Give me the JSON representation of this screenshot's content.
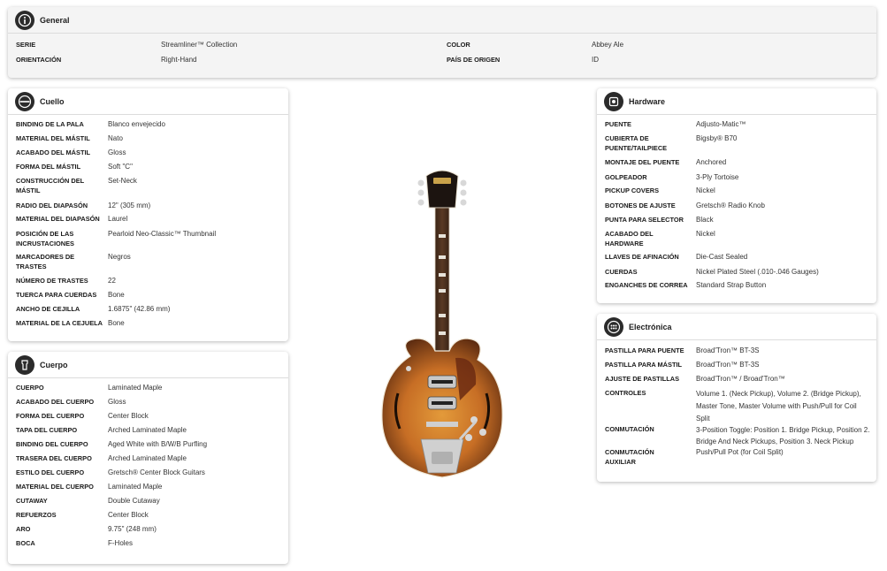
{
  "general": {
    "title": "General",
    "rows": [
      {
        "label": "SERIE",
        "value": "Streamliner™ Collection"
      },
      {
        "label": "ORIENTACIÓN",
        "value": "Right-Hand"
      },
      {
        "label": "COLOR",
        "value": "Abbey Ale"
      },
      {
        "label": "PAÍS DE ORIGEN",
        "value": "ID"
      }
    ]
  },
  "cuello": {
    "title": "Cuello",
    "rows": [
      {
        "label": "BINDING DE LA PALA",
        "value": "Blanco envejecido"
      },
      {
        "label": "MATERIAL DEL MÁSTIL",
        "value": "Nato"
      },
      {
        "label": "ACABADO DEL MÁSTIL",
        "value": "Gloss"
      },
      {
        "label": "FORMA DEL MÁSTIL",
        "value": "Soft \"C\""
      },
      {
        "label": "CONSTRUCCIÓN DEL MÁSTIL",
        "value": "Set-Neck"
      },
      {
        "label": "RADIO DEL DIAPASÓN",
        "value": "12\" (305 mm)"
      },
      {
        "label": "MATERIAL DEL DIAPASÓN",
        "value": "Laurel"
      },
      {
        "label": "POSICIÓN DE LAS INCRUSTACIONES",
        "value": "Pearloid Neo-Classic™ Thumbnail"
      },
      {
        "label": "MARCADORES DE TRASTES",
        "value": "Negros"
      },
      {
        "label": "NÚMERO DE TRASTES",
        "value": "22"
      },
      {
        "label": "TUERCA PARA CUERDAS",
        "value": "Bone"
      },
      {
        "label": "ANCHO DE CEJILLA",
        "value": "1.6875\" (42.86 mm)"
      },
      {
        "label": "MATERIAL DE LA CEJUELA",
        "value": "Bone"
      }
    ]
  },
  "cuerpo": {
    "title": "Cuerpo",
    "rows": [
      {
        "label": "CUERPO",
        "value": "Laminated Maple"
      },
      {
        "label": "ACABADO DEL CUERPO",
        "value": "Gloss"
      },
      {
        "label": "FORMA DEL CUERPO",
        "value": "Center Block"
      },
      {
        "label": "TAPA DEL CUERPO",
        "value": "Arched Laminated Maple"
      },
      {
        "label": "BINDING DEL CUERPO",
        "value": "Aged White with B/W/B Purfling"
      },
      {
        "label": "TRASERA DEL CUERPO",
        "value": "Arched Laminated Maple"
      },
      {
        "label": "ESTILO DEL CUERPO",
        "value": "Gretsch® Center Block Guitars"
      },
      {
        "label": "MATERIAL DEL CUERPO",
        "value": "Laminated Maple"
      },
      {
        "label": "CUTAWAY",
        "value": "Double Cutaway"
      },
      {
        "label": "REFUERZOS",
        "value": "Center Block"
      },
      {
        "label": "ARO",
        "value": "9.75\" (248 mm)"
      },
      {
        "label": "BOCA",
        "value": "F-Holes"
      }
    ]
  },
  "hardware": {
    "title": "Hardware",
    "rows": [
      {
        "label": "PUENTE",
        "value": "Adjusto-Matic™"
      },
      {
        "label": "CUBIERTA DE PUENTE/TAILPIECE",
        "value": "Bigsby® B70"
      },
      {
        "label": "MONTAJE DEL PUENTE",
        "value": "Anchored"
      },
      {
        "label": "GOLPEADOR",
        "value": "3-Ply Tortoise"
      },
      {
        "label": "PICKUP COVERS",
        "value": "Nickel"
      },
      {
        "label": "BOTONES DE AJUSTE",
        "value": "Gretsch® Radio Knob"
      },
      {
        "label": "PUNTA PARA SELECTOR",
        "value": "Black"
      },
      {
        "label": "ACABADO DEL HARDWARE",
        "value": "Nickel"
      },
      {
        "label": "LLAVES DE AFINACIÓN",
        "value": "Die-Cast Sealed"
      },
      {
        "label": "CUERDAS",
        "value": "Nickel Plated Steel (.010-.046 Gauges)"
      },
      {
        "label": "ENGANCHES DE CORREA",
        "value": "Standard Strap Button"
      }
    ]
  },
  "electronica": {
    "title": "Electrónica",
    "rows": [
      {
        "label": "PASTILLA PARA PUENTE",
        "value": "Broad'Tron™ BT-3S"
      },
      {
        "label": "PASTILLA PARA MÁSTIL",
        "value": "Broad'Tron™ BT-3S"
      },
      {
        "label": "AJUSTE DE PASTILLAS",
        "value": "Broad'Tron™ / Broad'Tron™"
      },
      {
        "label": "CONTROLES",
        "value": "Volume 1. (Neck Pickup), Volume 2. (Bridge Pickup), Master Tone, Master Volume with Push/Pull for Coil Split"
      },
      {
        "label": "CONMUTACIÓN",
        "value": "3-Position Toggle: Position 1. Bridge Pickup, Position 2. Bridge And Neck Pickups, Position 3. Neck Pickup"
      },
      {
        "label": "CONMUTACIÓN AUXILIAR",
        "value": "Push/Pull Pot (for Coil Split)"
      }
    ]
  },
  "icons": {
    "general": "info-icon",
    "cuello": "neck-icon",
    "cuerpo": "body-icon",
    "hardware": "hardware-icon",
    "electronica": "electronics-icon"
  },
  "colors": {
    "body_sunburst_center": "#d7892f",
    "body_sunburst_edge": "#5a2a10",
    "icon_badge": "#2b2b2b"
  }
}
